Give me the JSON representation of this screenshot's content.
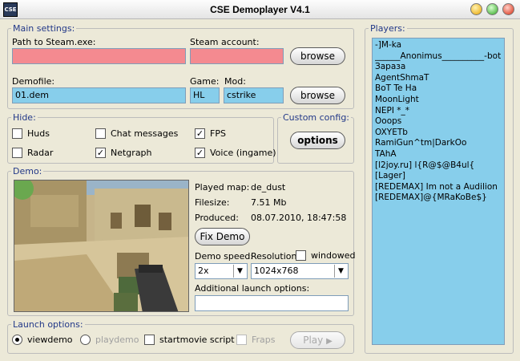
{
  "window": {
    "title": "CSE Demoplayer V4.1",
    "logo_text": "CSE",
    "colors": {
      "required_field": "#f48a90",
      "filled_field": "#87ceeb",
      "legend": "#223888"
    }
  },
  "main_settings": {
    "legend": "Main settings:",
    "steam_path_label": "Path to Steam.exe:",
    "steam_path_value": "",
    "steam_account_label": "Steam account:",
    "steam_account_value": "",
    "browse_label": "browse",
    "demofile_label": "Demofile:",
    "demofile_value": "01.dem",
    "game_label": "Game:",
    "game_value": "HL",
    "mod_label": "Mod:",
    "mod_value": "cstrike",
    "browse2_label": "browse"
  },
  "hide": {
    "legend": "Hide:",
    "huds": {
      "label": "Huds",
      "checked": false
    },
    "chat": {
      "label": "Chat messages",
      "checked": false
    },
    "fps": {
      "label": "FPS",
      "checked": true
    },
    "radar": {
      "label": "Radar",
      "checked": false
    },
    "netgraph": {
      "label": "Netgraph",
      "checked": true
    },
    "voice": {
      "label": "Voice (ingame)",
      "checked": true
    }
  },
  "custom_config": {
    "legend": "Custom config:",
    "options_label": "options"
  },
  "demo": {
    "legend": "Demo:",
    "map_label": "Played map:",
    "map_value": "de_dust",
    "filesize_label": "Filesize:",
    "filesize_value": "7.51 Mb",
    "produced_label": "Produced:",
    "produced_value": "08.07.2010, 18:47:58",
    "fix_label": "Fix Demo",
    "speed_label": "Demo speed:",
    "speed_value": "2x",
    "resolution_label": "Resolution:",
    "resolution_value": "1024x768",
    "windowed_label": "windowed",
    "windowed_checked": false,
    "launch_opts_label": "Additional launch options:",
    "launch_opts_value": ""
  },
  "launch": {
    "legend": "Launch options:",
    "viewdemo_label": "viewdemo",
    "playdemo_label": "playdemo",
    "startmovie_label": "startmovie script",
    "fraps_label": "Fraps",
    "play_label": "Play",
    "play_icon": "play-arrow-icon",
    "selected_mode": "viewdemo"
  },
  "players": {
    "legend": "Players:",
    "list": [
      "-]M-ka",
      "______Anonimus__________-bot",
      "Зараза",
      "AgentShmaT",
      "BoT Te Ha",
      "MoonLight",
      "NEPI      *_*",
      "Ooops",
      "OXYETb",
      "RamiGun^tm|DarkOo",
      "TAhA",
      "[l2joy.ru] l{R@$@B4ul{",
      "[Lager]",
      "[REDEMAX] Im not a Audilion",
      "[REDEMAX]@{MRaKoBe$}"
    ]
  }
}
